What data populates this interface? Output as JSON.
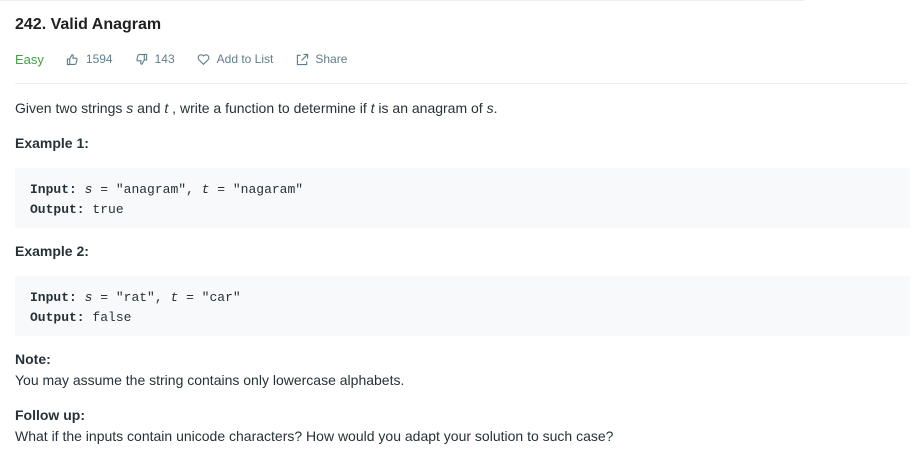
{
  "problem": {
    "title": "242. Valid Anagram",
    "difficulty": "Easy",
    "likes": "1594",
    "dislikes": "143",
    "add_to_list_label": "Add to List",
    "share_label": "Share",
    "colors": {
      "difficulty": "#43a047",
      "meta_text": "#607d8b",
      "code_bg": "#f7f9fa"
    }
  },
  "description": {
    "prefix": "Given two strings ",
    "var_s": "s",
    "and": " and ",
    "var_t": "t",
    "middle": " , write a function to determine if ",
    "var_t2": "t",
    "is_anagram": " is an anagram of ",
    "var_s2": "s",
    "suffix": "."
  },
  "example1": {
    "heading": "Example 1:",
    "input_label": "Input:",
    "var_s": "s",
    "s_value": " = \"anagram\", ",
    "var_t": "t",
    "t_value": " = \"nagaram\"",
    "output_label": "Output:",
    "output_value": " true"
  },
  "example2": {
    "heading": "Example 2:",
    "input_label": "Input:",
    "var_s": "s",
    "s_value": " = \"rat\", ",
    "var_t": "t",
    "t_value": " = \"car\"",
    "output_label": "Output:",
    "output_value": " false"
  },
  "note": {
    "heading": "Note:",
    "text": "You may assume the string contains only lowercase alphabets."
  },
  "follow_up": {
    "heading": "Follow up:",
    "text": "What if the inputs contain unicode characters? How would you adapt your solution to such case?"
  }
}
